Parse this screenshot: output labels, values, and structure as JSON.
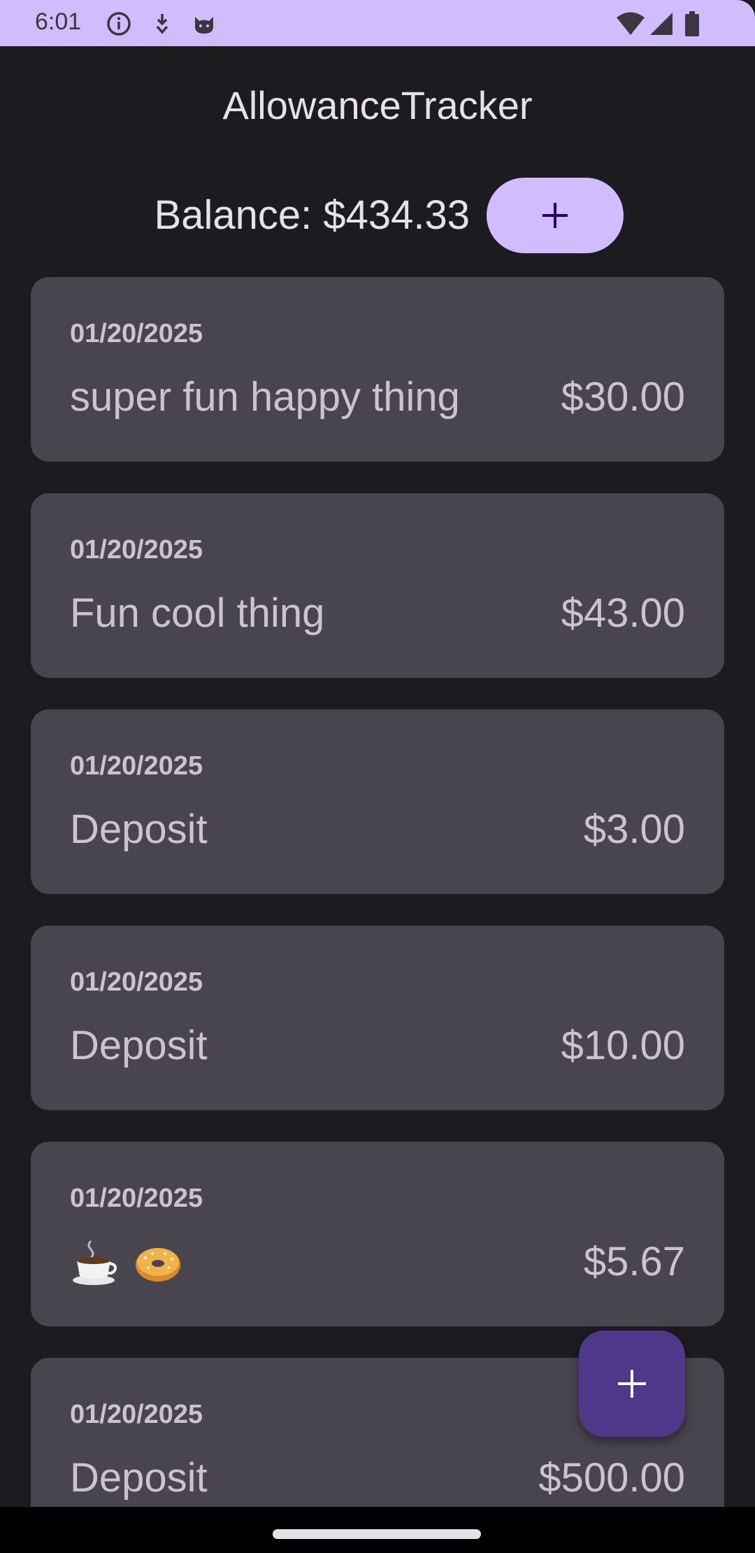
{
  "status_bar": {
    "time": "6:01",
    "left_icons": [
      "info-icon",
      "download-arrow-icon",
      "cat-face-icon"
    ],
    "right_icons": [
      "wifi-icon",
      "signal-icon",
      "battery-icon"
    ]
  },
  "header": {
    "title": "AllowanceTracker"
  },
  "balance": {
    "label": "Balance: $434.33",
    "add_icon": "plus-icon"
  },
  "transactions": [
    {
      "date": "01/20/2025",
      "title": "super fun happy thing",
      "amount": "$30.00"
    },
    {
      "date": "01/20/2025",
      "title": "Fun cool thing",
      "amount": "$43.00"
    },
    {
      "date": "01/20/2025",
      "title": "Deposit",
      "amount": "$3.00"
    },
    {
      "date": "01/20/2025",
      "title": "Deposit",
      "amount": "$10.00"
    },
    {
      "date": "01/20/2025",
      "title": "☕ 🥯",
      "title_icons": [
        "coffee-icon",
        "bagel-icon"
      ],
      "amount": "$5.67"
    },
    {
      "date": "01/20/2025",
      "title": "Deposit",
      "amount": "$500.00"
    }
  ],
  "fab": {
    "icon": "plus-icon"
  },
  "colors": {
    "status_bar": "#d0bcfe",
    "background": "#1c1b20",
    "card": "#49454f",
    "text_primary": "#e6e1e9",
    "text_card": "#cac4cf",
    "balance_button": "#d0bcfe",
    "fab": "#4f378a"
  }
}
